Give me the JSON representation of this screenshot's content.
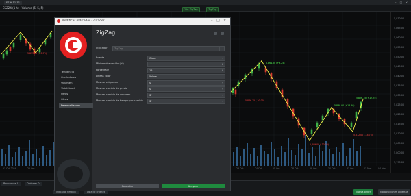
{
  "window": {
    "tab_title": "ES.H 11-11",
    "close": "×"
  },
  "toolbar": {
    "symbol": "ESZ24 (1 h) - Volume (5, 5, 5)",
    "btn_left": "1 h: ZigZag",
    "btn_right": "ZigZag"
  },
  "chart": {
    "price_labels": [
      "5,870.00",
      "5,865.00",
      "5,860.00",
      "5,855.00",
      "5,850.00",
      "5,845.00",
      "5,840.00",
      "5,835.00",
      "5,830.00",
      "5,825.00",
      "5,820.00",
      "5,815.00",
      "5,810.00",
      "5,805.00",
      "5,800.00",
      "5,795.00"
    ],
    "time_labels": [
      "21 Oct 2024",
      "22 Oct",
      "23 Oct",
      "24 Oct",
      "25 Oct",
      "28 Oct",
      "29 Oct",
      "30 Oct",
      "31 Oct",
      "01 Nov",
      "04 Nov"
    ],
    "annotations": [
      {
        "text": "5,855.25 (-10.75)",
        "color": "#ff4040"
      },
      {
        "text": "5,864.50 (+9.25)",
        "color": "#55ff55"
      },
      {
        "text": "5,846.75 (-20.00)",
        "color": "#ff4040"
      },
      {
        "text": "5,839.00 (+18.50)",
        "color": "#55ff55"
      },
      {
        "text": "5,809.00 (-30.00)",
        "color": "#ff4040"
      },
      {
        "text": "5,826.75 (+17.75)",
        "color": "#55ff55"
      },
      {
        "text": "5,812.00 (-14.75)",
        "color": "#ff4040"
      }
    ]
  },
  "modal": {
    "title": "Modificar indicador - cTrader",
    "indicator_name": "ZigZag",
    "indicator_field_label": "Indicador",
    "indicator_field_value": "ZigZag",
    "categories": [
      "Tendencia",
      "Osciladores",
      "Volumen",
      "Volatilidad",
      "Otros",
      "Otros",
      "Personalizados"
    ],
    "rows": [
      {
        "label": "Fuente",
        "value": "Close"
      },
      {
        "label": "Mínima desviación (%)",
        "value": ""
      },
      {
        "label": "Porcentaje",
        "value": "15"
      },
      {
        "label": "Líneas color",
        "value": "Yellow"
      },
      {
        "label": "Mostrar etiquetas",
        "value": "Sí"
      },
      {
        "label": "Mostrar cambio de precio",
        "value": "Sí"
      },
      {
        "label": "Mostrar cambio de volumen",
        "value": "Sí"
      },
      {
        "label": "Mostrar cambio de tiempo por cambio",
        "value": "Sí"
      }
    ],
    "cancel_label": "Cancelar",
    "accept_label": "Aceptar"
  },
  "bottom": {
    "tabs": [
      "Posiciones 0",
      "Órdenes 0"
    ],
    "taskbar": [
      "Indicador Símbolo",
      "Lista de órdenes"
    ],
    "new_order": "Nueva orden",
    "no_positions": "No posiciones abiertas"
  },
  "colors": {
    "accent": "#1f8a3e",
    "zigzag": "#f4f04a",
    "bull": "#3fae49",
    "bear": "#d63b2f",
    "volume": "#4d7aa6"
  }
}
